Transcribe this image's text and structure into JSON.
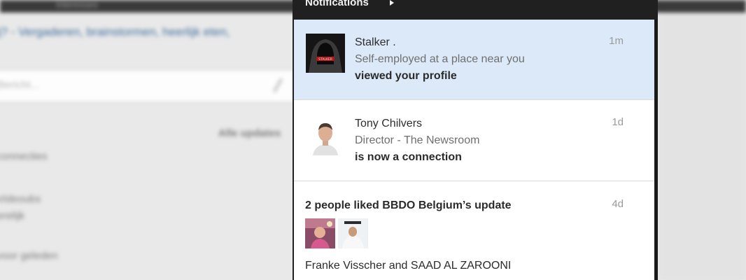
{
  "background": {
    "topbar_item": "Interesses",
    "link_text": "ij? - Vergaderen, brainstormen, heerlijk eten,",
    "input_placeholder": "Bericht...",
    "filter_label": "Alle updates",
    "sidebar_texts": [
      "connecties",
      "Videoubs",
      "erelijk",
      "voor geleden"
    ]
  },
  "panel": {
    "title": "Notifications",
    "notifications": [
      {
        "name": "Stalker .",
        "subtitle": "Self-employed at a place near you",
        "action": "viewed your profile",
        "time": "1m",
        "avatar_text": "STALKER"
      },
      {
        "name": "Tony Chilvers",
        "subtitle": "Director - The Newsroom",
        "action": "is now a connection",
        "time": "1d"
      },
      {
        "headline": "2 people liked BBDO Belgium’s update",
        "time": "4d",
        "names": "Franke Visscher and SAAD AL ZAROONI"
      }
    ]
  },
  "colors": {
    "highlight": "#dce9f8",
    "panel_dark": "#202020",
    "link_blue": "#3d6e9b"
  }
}
